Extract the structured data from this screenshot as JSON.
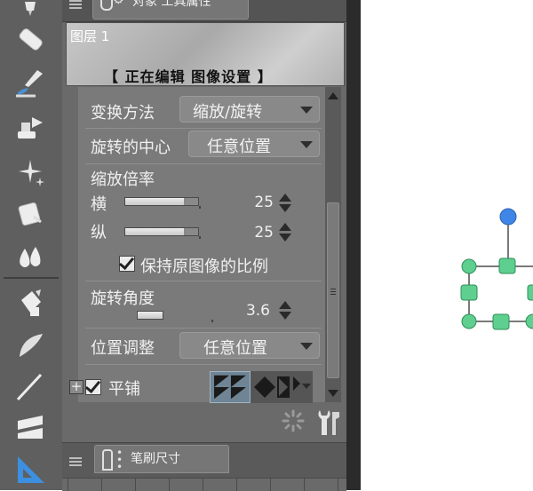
{
  "toolbar": {
    "tools": [
      {
        "icon": "pen-icon"
      },
      {
        "icon": "eraser-icon"
      },
      {
        "icon": "brush-icon"
      },
      {
        "icon": "stamp-icon"
      },
      {
        "icon": "sparkle-icon"
      },
      {
        "icon": "copy-tool-icon"
      },
      {
        "icon": "blend-drops-icon"
      },
      {
        "icon": "fill-bucket-icon"
      },
      {
        "icon": "gradient-icon"
      },
      {
        "icon": "line-icon"
      },
      {
        "icon": "frame-icon"
      },
      {
        "icon": "ruler-icon"
      }
    ]
  },
  "top_tab": {
    "label": "对象 工具属性"
  },
  "preview": {
    "layer_name": "图层 1",
    "edit_status": "【 正在编辑 图像设置 】"
  },
  "properties": {
    "transform_method": {
      "label": "变换方法",
      "value": "缩放/旋转"
    },
    "rotation_center": {
      "label": "旋转的中心",
      "value": "任意位置"
    },
    "scale": {
      "label": "缩放倍率",
      "horizontal": {
        "label": "横",
        "value": "25",
        "fraction": 0.25
      },
      "vertical": {
        "label": "纵",
        "value": "25",
        "fraction": 0.25
      }
    },
    "keep_ratio": {
      "label": "保持原图像的比例",
      "checked": true
    },
    "rotation_angle": {
      "label": "旋转角度",
      "value": "3.6",
      "fraction": 0.02
    },
    "position_adjust": {
      "label": "位置调整",
      "value": "任意位置"
    },
    "tile": {
      "label": "平铺",
      "checked": true
    }
  },
  "bottom_tab": {
    "label": "笔刷尺寸"
  },
  "colors": {
    "handle_green": "#5fcf8f",
    "handle_blue": "#3f86e6",
    "selection_tile": "#6f8595"
  }
}
